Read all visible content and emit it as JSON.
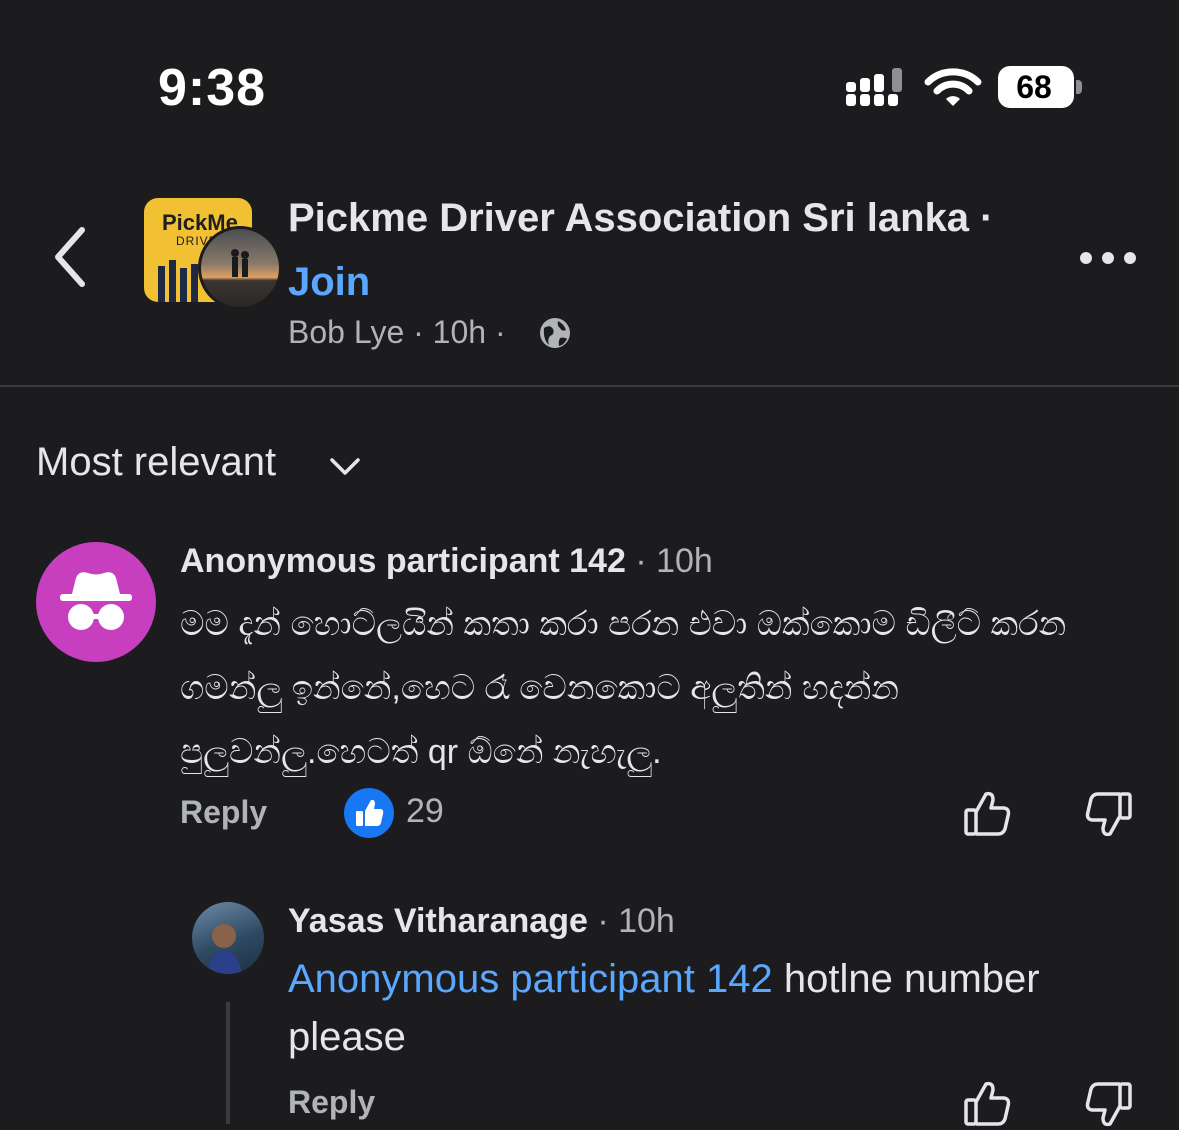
{
  "status_bar": {
    "time": "9:38",
    "battery": "68"
  },
  "header": {
    "group_name": "Pickme Driver Association Sri lanka ·",
    "join_label": "Join",
    "author": "Bob Lye",
    "time": "10h",
    "logo_text": "PickMe",
    "logo_subtext": "DRIVER",
    "icons": [
      "back-chevron-icon",
      "globe-icon",
      "more-icon"
    ]
  },
  "sort": {
    "label": "Most relevant"
  },
  "comments": [
    {
      "author": "Anonymous participant 142",
      "time": "· 10h",
      "text": "මම දැන් හොට්ලයින් කතා කරා පරන එවා ඔක්කොම ඩිලීට් කරන ගමන්ලු ඉන්නේ,හෙට රෑ වෙනකොට අලුතින් හදන්න පුලුවන්ලු.හෙටත් qr ඕනේ නැහැලු.",
      "reply_label": "Reply",
      "like_count": "29"
    }
  ],
  "replies": [
    {
      "author": "Yasas Vitharanage",
      "time": "· 10h",
      "mention": "Anonymous participant 142",
      "text": " hotlne number please",
      "reply_label": "Reply"
    }
  ],
  "colors": {
    "background": "#1c1c1e",
    "accent": "#5aa7ff",
    "anon_avatar": "#c73fbf",
    "like": "#1877f2"
  }
}
